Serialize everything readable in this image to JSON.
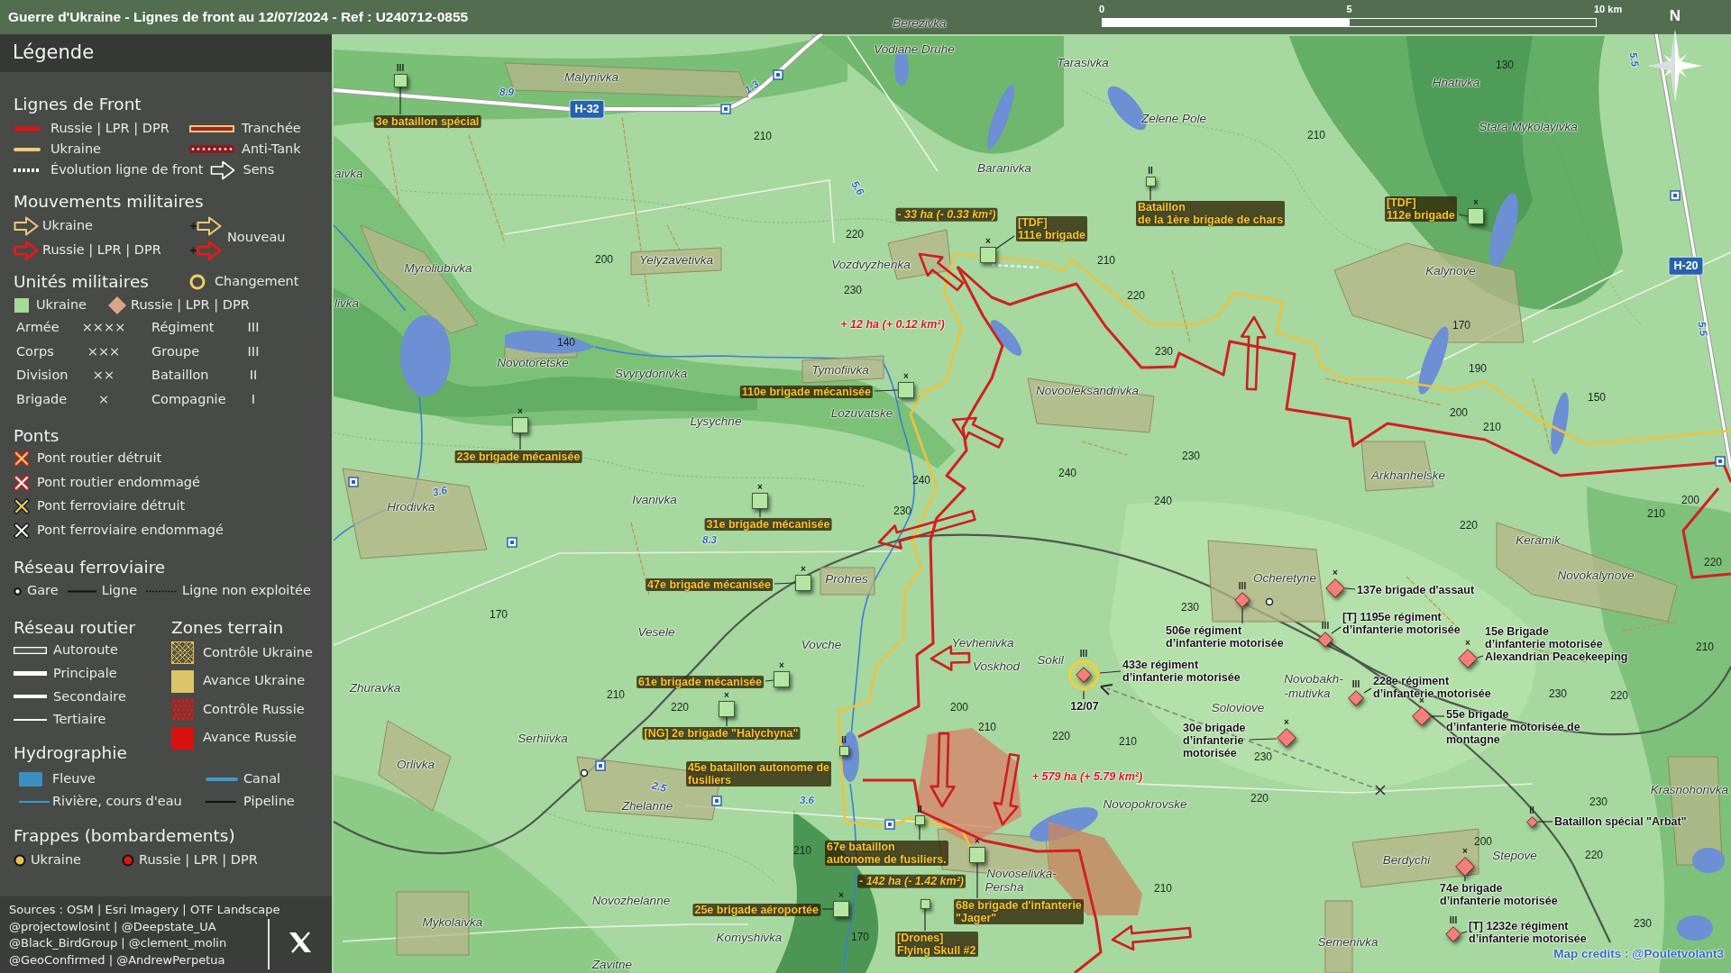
{
  "title_bar": {
    "title": "Guerre d'Ukraine - Lignes de front au 12/07/2024 - Ref : U240712-0855",
    "scale_ticks": [
      "0",
      "5",
      "10 km"
    ],
    "compass": "N"
  },
  "legend": {
    "title": "Légende",
    "front_lines": {
      "heading": "Lignes de Front",
      "items": [
        {
          "kind": "russia_line",
          "label": "Russie | LPR | DPR"
        },
        {
          "kind": "trench",
          "label": "Tranchée"
        },
        {
          "kind": "ukraine_line",
          "label": "Ukraine"
        },
        {
          "kind": "anti_tank",
          "label": "Anti-Tank"
        },
        {
          "kind": "evolution",
          "label": "Évolution ligne de front"
        },
        {
          "kind": "direction",
          "label": "Sens"
        }
      ]
    },
    "movements": {
      "heading": "Mouvements militaires",
      "items": [
        {
          "kind": "ukraine",
          "label": "Ukraine"
        },
        {
          "kind": "russia",
          "label": "Russie | LPR | DPR"
        }
      ],
      "new_label": "Nouveau"
    },
    "units": {
      "heading": "Unités militaires",
      "change_label": "Changement",
      "sides": [
        {
          "kind": "ukraine",
          "label": "Ukraine"
        },
        {
          "kind": "russia",
          "label": "Russie | LPR | DPR"
        }
      ],
      "echelons": [
        {
          "name": "Armée",
          "symbol": "××××"
        },
        {
          "name": "Régiment",
          "symbol": "III"
        },
        {
          "name": "Corps",
          "symbol": "×××"
        },
        {
          "name": "Groupe",
          "symbol": "III"
        },
        {
          "name": "Division",
          "symbol": "××"
        },
        {
          "name": "Bataillon",
          "symbol": "II"
        },
        {
          "name": "Brigade",
          "symbol": "×"
        },
        {
          "name": "Compagnie",
          "symbol": "I"
        }
      ]
    },
    "bridges": {
      "heading": "Ponts",
      "items": [
        {
          "kind": "road_destroyed",
          "label": "Pont routier détruit"
        },
        {
          "kind": "road_damaged",
          "label": "Pont routier endommagé"
        },
        {
          "kind": "rail_destroyed",
          "label": "Pont ferroviaire détruit"
        },
        {
          "kind": "rail_damaged",
          "label": "Pont ferroviaire endommagé"
        }
      ]
    },
    "railway": {
      "heading": "Réseau ferroviaire",
      "items": [
        {
          "kind": "station",
          "label": "Gare"
        },
        {
          "kind": "line",
          "label": "Ligne"
        },
        {
          "kind": "disused",
          "label": "Ligne non exploitée"
        }
      ]
    },
    "roads": {
      "heading": "Réseau routier",
      "items": [
        {
          "kind": "motorway",
          "label": "Autoroute"
        },
        {
          "kind": "primary",
          "label": "Principale"
        },
        {
          "kind": "secondary",
          "label": "Secondaire"
        },
        {
          "kind": "tertiary",
          "label": "Tertiaire"
        }
      ]
    },
    "zones": {
      "heading": "Zones terrain",
      "items": [
        {
          "kind": "ukraine_control",
          "label": "Contrôle Ukraine"
        },
        {
          "kind": "ukraine_advance",
          "label": "Avance Ukraine"
        },
        {
          "kind": "russia_control",
          "label": "Contrôle Russie"
        },
        {
          "kind": "russia_advance",
          "label": "Avance Russie"
        }
      ]
    },
    "hydrography": {
      "heading": "Hydrographie",
      "items": [
        {
          "kind": "river",
          "label": "Fleuve"
        },
        {
          "kind": "canal",
          "label": "Canal"
        },
        {
          "kind": "stream",
          "label": "Rivière, cours d'eau"
        },
        {
          "kind": "pipeline",
          "label": "Pipeline"
        }
      ]
    },
    "strikes": {
      "heading": "Frappes (bombardements)",
      "items": [
        {
          "label": "Ukraine",
          "color": "#e8c25a"
        },
        {
          "label": "Russie | LPR | DPR",
          "color": "#e01414"
        }
      ]
    },
    "sources": [
      "Sources : OSM | Esri Imagery | OTF Landscape",
      "@projectowlosint | @Deepstate_UA",
      "@Black_BirdGroup | @clement_molin",
      "@GeoConfirmed | @AndrewPerpetua"
    ]
  },
  "map": {
    "places": [
      "Berezivka",
      "Vodiane Druhe",
      "Tarasivka",
      "Malynivka",
      "Hnativka",
      "Zelene Pole",
      "Stara Mykolayivka",
      "aivka",
      "Baranivka",
      "Myroliubivka",
      "Yelyzavetivka",
      "Vozdvyzhenka",
      "Kalynove",
      "livka",
      "Novotoretske",
      "Svyrydonivka",
      "Tymofiivka",
      "Novooleksandrivka",
      "Lysychne",
      "Lozuvatske",
      "Arkhanhelske",
      "Hrodivka",
      "Ivanivka",
      "Keramik",
      "Prohres",
      "Ocheretyne",
      "Novokalynove",
      "Vesele",
      "Vovche",
      "Yevhenivka",
      "Voskhod",
      "Sokil",
      "Zhuravka",
      "Novobakh-",
      "-mutivka",
      "Soloviove",
      "Serhiivka",
      "Orlivka",
      "Krasnohorivka",
      "Zhelanne",
      "Novopokrovske",
      "Berdychi",
      "Stepove",
      "Novoselivka-",
      "Persha",
      "Novozhelanne",
      "Mykolaivka",
      "Komyshivka",
      "Semenivka",
      "Zavitne"
    ],
    "elevations": [
      "130",
      "210",
      "210",
      "220",
      "200",
      "210",
      "230",
      "220",
      "170",
      "140",
      "230",
      "190",
      "150",
      "200",
      "210",
      "230",
      "240",
      "240",
      "240",
      "200",
      "230",
      "210",
      "220",
      "220",
      "170",
      "230",
      "210",
      "210",
      "230",
      "220",
      "220",
      "200",
      "210",
      "220",
      "210",
      "230",
      "220",
      "230",
      "210",
      "200",
      "220",
      "210",
      "230",
      "170"
    ],
    "road_numbers": [
      "H-32",
      "H-20"
    ],
    "distances": [
      "5.5",
      "8.9",
      "1.3",
      "5.6",
      "5.5",
      "3.6",
      "8.3",
      "2.5",
      "3.6"
    ],
    "area_changes": [
      {
        "kind": "ukraine",
        "text": "- 33 ha (- 0.33 km²)"
      },
      {
        "kind": "russia",
        "text": "+ 12 ha (+ 0.12 km²)"
      },
      {
        "kind": "russia",
        "text": "+ 579 ha (+ 5.79 km²)"
      },
      {
        "kind": "ukraine",
        "text": "- 142 ha (- 1.42 km²)"
      }
    ],
    "units": [
      {
        "kind": "ukraine",
        "echelon": "III",
        "lines": [
          "3e bataillon spécial"
        ],
        "changed": false
      },
      {
        "kind": "ukraine",
        "echelon": "×",
        "lines": [
          "[TDF]",
          "111e brigade"
        ],
        "changed": false
      },
      {
        "kind": "ukraine",
        "echelon": "II",
        "lines": [
          "Bataillon",
          "de la 1ère brigade de chars"
        ],
        "changed": false
      },
      {
        "kind": "ukraine",
        "echelon": "×",
        "lines": [
          "[TDF]",
          "112e brigade"
        ],
        "changed": false
      },
      {
        "kind": "ukraine",
        "echelon": "×",
        "lines": [
          "110e brigade mécanisée"
        ],
        "changed": false
      },
      {
        "kind": "ukraine",
        "echelon": "×",
        "lines": [
          "23e brigade mécanisée"
        ],
        "changed": false
      },
      {
        "kind": "ukraine",
        "echelon": "×",
        "lines": [
          "31e brigade mécanisée"
        ],
        "changed": false
      },
      {
        "kind": "ukraine",
        "echelon": "×",
        "lines": [
          "47e brigade mécanisée"
        ],
        "changed": false
      },
      {
        "kind": "russia",
        "echelon": "III",
        "lines": [
          "506e régiment",
          "d’infanterie motorisée"
        ],
        "changed": false
      },
      {
        "kind": "russia",
        "echelon": "×",
        "lines": [
          "137e brigade d'assaut"
        ],
        "changed": false
      },
      {
        "kind": "russia",
        "echelon": "III",
        "lines": [
          "[T] 1195e régiment",
          "d’infanterie motorisée"
        ],
        "changed": false
      },
      {
        "kind": "ukraine",
        "echelon": "×",
        "lines": [
          "61e brigade mécanisée"
        ],
        "changed": false
      },
      {
        "kind": "russia",
        "echelon": "III",
        "lines": [
          "433e régiment",
          "d’infanterie motorisée"
        ],
        "changed": true,
        "date": "12/07"
      },
      {
        "kind": "russia",
        "echelon": "×",
        "lines": [
          "15e Brigade",
          "d’infanterie motorisée",
          "Alexandrian Peacekeeping"
        ],
        "changed": false
      },
      {
        "kind": "ukraine",
        "echelon": "×",
        "lines": [
          "[NG] 2e brigade \"Halychyna\""
        ],
        "changed": false
      },
      {
        "kind": "russia",
        "echelon": "III",
        "lines": [
          "228e régiment",
          "d’infanterie motorisée"
        ],
        "changed": false
      },
      {
        "kind": "ukraine",
        "echelon": "II",
        "lines": [
          "45e bataillon autonome de",
          "fusiliers"
        ],
        "changed": false
      },
      {
        "kind": "russia",
        "echelon": "×",
        "lines": [
          "30e brigade",
          "d’infanterie",
          "motorisée"
        ],
        "changed": false
      },
      {
        "kind": "russia",
        "echelon": "×",
        "lines": [
          "55e brigade",
          "d’infanterie motorisée de",
          "montagne"
        ],
        "changed": false
      },
      {
        "kind": "ukraine",
        "echelon": "II",
        "lines": [
          "67e bataillon",
          "autonome de fusiliers."
        ],
        "changed": false
      },
      {
        "kind": "russia",
        "echelon": "II",
        "lines": [
          "Bataillon spécial \"Arbat\""
        ],
        "changed": false
      },
      {
        "kind": "ukraine",
        "echelon": "×",
        "lines": [
          "25e brigade aéroportée"
        ],
        "changed": false
      },
      {
        "kind": "ukraine",
        "echelon": "×",
        "lines": [
          "68e brigade d'infanterie",
          "\"Jager\""
        ],
        "changed": false
      },
      {
        "kind": "russia",
        "echelon": "×",
        "lines": [
          "74e brigade",
          "d’infanterie motorisée"
        ],
        "changed": false
      },
      {
        "kind": "ukraine",
        "lines": [
          "[Drones]",
          "Flying Skull #2"
        ],
        "changed": false
      },
      {
        "kind": "russia",
        "echelon": "III",
        "lines": [
          "[T] 1232e régiment",
          "d’infanterie motorisée"
        ],
        "changed": false
      }
    ],
    "credits": "Map credits : @Pouletvolant3"
  }
}
